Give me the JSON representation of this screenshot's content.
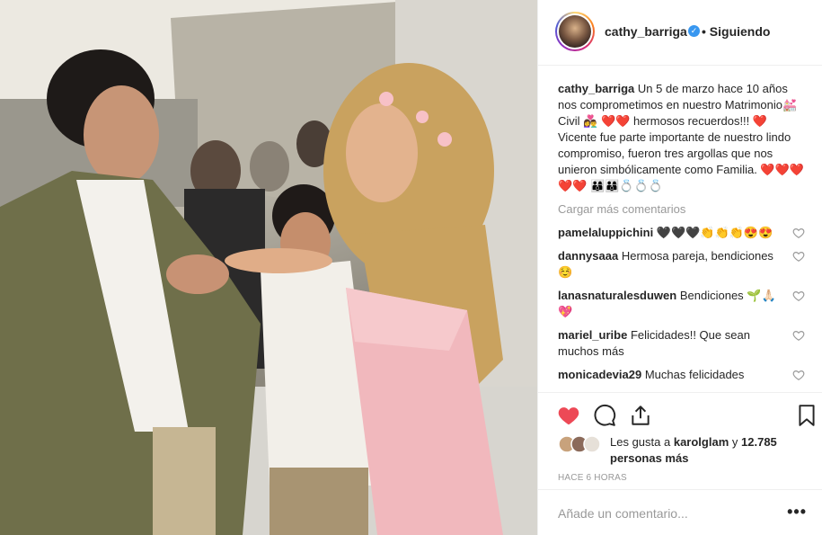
{
  "post": {
    "username": "cathy_barriga",
    "follow_status": "• Siguiendo",
    "verified_mark": "✓"
  },
  "caption": {
    "user": "cathy_barriga",
    "text": "Un 5 de marzo hace 10 años nos comprometimos en nuestro Matrimonio💒 Civil 👩‍❤️‍👨 ❤️❤️ hermosos recuerdos!!! ❤️ Vicente fue parte importante de nuestro lindo compromiso, fueron tres argollas que nos unieron simbólicamente como Familia. ❤️❤️❤️❤️❤️ 👨‍👩‍👦👨‍👩‍👦💍💍💍"
  },
  "load_more": "Cargar más comentarios",
  "comments": [
    {
      "user": "pamelaluppichini",
      "text": "🖤🖤🖤👏👏👏😍😍"
    },
    {
      "user": "dannysaaa",
      "text": "Hermosa pareja, bendiciones☺️"
    },
    {
      "user": "lanasnaturalesduwen",
      "text": "Bendiciones 🌱🙏🏻💖"
    },
    {
      "user": "mariel_uribe",
      "text": "Felicidades!! Que sean muchos más"
    },
    {
      "user": "monicadevia29",
      "text": "Muchas felicidades"
    }
  ],
  "likes": {
    "prefix": "Les gusta a",
    "user": "karolglam",
    "joiner": "y",
    "count": "12.785 personas más"
  },
  "timestamp": "HACE 6 HORAS",
  "add_comment_placeholder": "Añade un comentario...",
  "more_options": "•••",
  "colors": {
    "like_red": "#ed4956",
    "verified_blue": "#3897f0",
    "muted": "#999999"
  },
  "icons": [
    "heart-filled-icon",
    "comment-icon",
    "share-icon",
    "bookmark-icon",
    "heart-outline-icon",
    "verified-icon"
  ]
}
